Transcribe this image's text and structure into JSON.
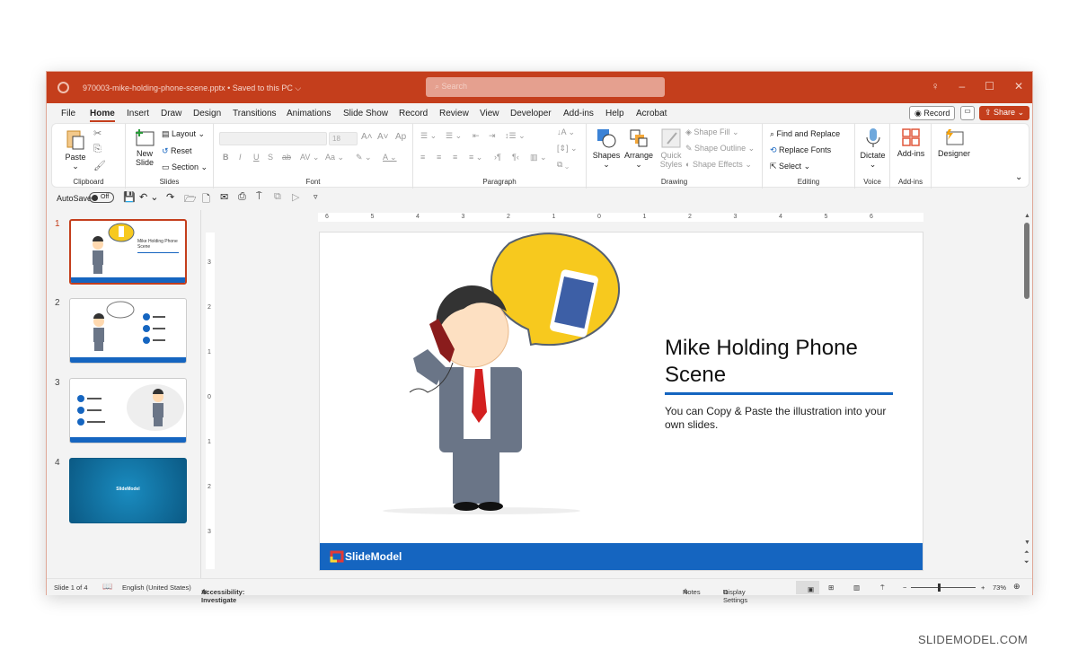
{
  "window": {
    "filename": "970003-mike-holding-phone-scene.pptx",
    "save_status": "Saved to this PC",
    "search_placeholder": "Search"
  },
  "menu": {
    "tabs": [
      "File",
      "Home",
      "Insert",
      "Draw",
      "Design",
      "Transitions",
      "Animations",
      "Slide Show",
      "Record",
      "Review",
      "View",
      "Developer",
      "Add-ins",
      "Help",
      "Acrobat"
    ],
    "active_tab": "Home",
    "record_label": "Record",
    "share_label": "Share"
  },
  "ribbon": {
    "clipboard": {
      "paste": "Paste",
      "label": "Clipboard"
    },
    "slides": {
      "new_slide": "New Slide",
      "layout": "Layout",
      "reset": "Reset",
      "section": "Section",
      "label": "Slides"
    },
    "font": {
      "font_name": "",
      "font_size": "18",
      "label": "Font"
    },
    "paragraph": {
      "label": "Paragraph"
    },
    "drawing": {
      "shapes": "Shapes",
      "arrange": "Arrange",
      "quick_styles": "Quick Styles",
      "shape_fill": "Shape Fill",
      "shape_outline": "Shape Outline",
      "shape_effects": "Shape Effects",
      "label": "Drawing"
    },
    "editing": {
      "find_replace": "Find and Replace",
      "replace_fonts": "Replace Fonts",
      "select": "Select",
      "label": "Editing"
    },
    "voice": {
      "dictate": "Dictate",
      "label": "Voice"
    },
    "addins": {
      "addins": "Add-ins",
      "label": "Add-ins"
    },
    "designer": {
      "designer": "Designer"
    }
  },
  "qat": {
    "autosave_label": "AutoSave",
    "autosave_state": "Off"
  },
  "thumbnails": [
    {
      "num": "1",
      "active": true,
      "title": "Mike Holding Phone Scene"
    },
    {
      "num": "2",
      "active": false,
      "title": ""
    },
    {
      "num": "3",
      "active": false,
      "title": ""
    },
    {
      "num": "4",
      "active": false,
      "title": "SlideModel"
    }
  ],
  "ruler": {
    "h_ticks": [
      "6",
      "5",
      "4",
      "3",
      "2",
      "1",
      "0",
      "1",
      "2",
      "3",
      "4",
      "5",
      "6"
    ],
    "v_ticks": [
      "3",
      "2",
      "1",
      "0",
      "1",
      "2",
      "3"
    ]
  },
  "slide": {
    "title": "Mike Holding Phone Scene",
    "subtitle": "You can Copy & Paste the illustration into your own slides.",
    "footer_logo": "SlideModel",
    "accent": "#1565c0"
  },
  "status": {
    "slide_count": "Slide 1 of 4",
    "language": "English (United States)",
    "accessibility": "Accessibility: Investigate",
    "notes": "Notes",
    "display_settings": "Display Settings",
    "zoom": "73%",
    "zoom_fraction": 0.42
  },
  "watermark": "SLIDEMODEL.COM",
  "colors": {
    "brand": "#c43e1c",
    "slide_blue": "#1565c0"
  }
}
